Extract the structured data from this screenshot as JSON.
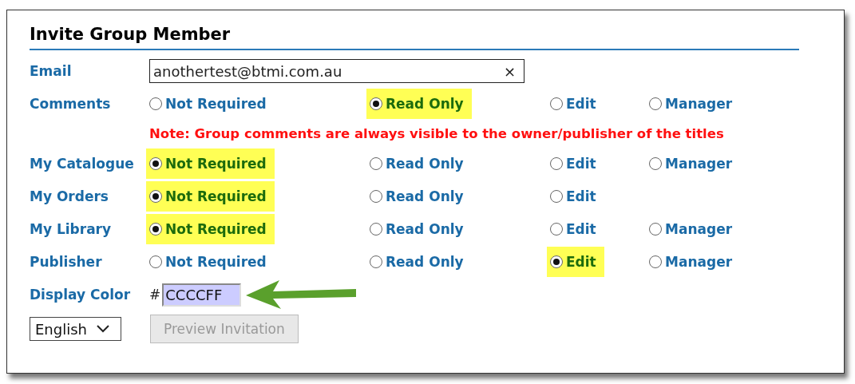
{
  "title": "Invite Group Member",
  "email": {
    "label": "Email",
    "value": "anothertest@btmi.com.au",
    "clear": "×"
  },
  "permissions": [
    {
      "label": "Comments",
      "options": [
        {
          "label": "Not Required",
          "selected": false
        },
        {
          "label": "Read Only",
          "selected": true
        },
        {
          "label": "Edit",
          "selected": false
        },
        {
          "label": "Manager",
          "selected": false
        }
      ]
    },
    {
      "kind": "note",
      "text": "Note: Group comments are always visible to the owner/publisher of the titles"
    },
    {
      "label": "My Catalogue",
      "options": [
        {
          "label": "Not Required",
          "selected": true
        },
        {
          "label": "Read Only",
          "selected": false
        },
        {
          "label": "Edit",
          "selected": false
        },
        {
          "label": "Manager",
          "selected": false
        }
      ]
    },
    {
      "label": "My Orders",
      "options": [
        {
          "label": "Not Required",
          "selected": true
        },
        {
          "label": "Read Only",
          "selected": false
        },
        {
          "label": "Edit",
          "selected": false
        }
      ]
    },
    {
      "label": "My Library",
      "options": [
        {
          "label": "Not Required",
          "selected": true
        },
        {
          "label": "Read Only",
          "selected": false
        },
        {
          "label": "Edit",
          "selected": false
        },
        {
          "label": "Manager",
          "selected": false
        }
      ]
    },
    {
      "label": "Publisher",
      "options": [
        {
          "label": "Not Required",
          "selected": false
        },
        {
          "label": "Read Only",
          "selected": false
        },
        {
          "label": "Edit",
          "selected": true
        },
        {
          "label": "Manager",
          "selected": false
        }
      ]
    }
  ],
  "display_color": {
    "label": "Display Color",
    "prefix": "#",
    "value": "CCCCFF"
  },
  "language": {
    "value": "English"
  },
  "preview_button": {
    "label": "Preview Invitation",
    "disabled": true
  }
}
